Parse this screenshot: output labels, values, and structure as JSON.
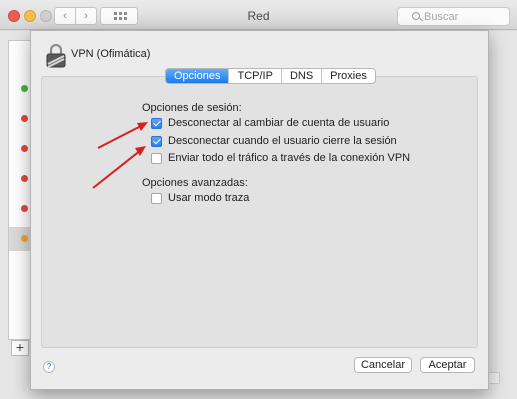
{
  "window": {
    "title": "Red",
    "search_placeholder": "Buscar",
    "back_glyph": "‹",
    "forward_glyph": "›",
    "add_glyph": "+",
    "help_glyph": "?"
  },
  "service_list": {
    "status_colors": [
      "#3fb642",
      "#e04a43",
      "#e04a43",
      "#e04a43",
      "#e04a43",
      "#f0a536"
    ]
  },
  "sheet": {
    "vpn_name": "VPN (Ofimática)",
    "tabs": [
      {
        "label": "Opciones",
        "active": true
      },
      {
        "label": "TCP/IP",
        "active": false
      },
      {
        "label": "DNS",
        "active": false
      },
      {
        "label": "Proxies",
        "active": false
      }
    ],
    "session_options_title": "Opciones de sesión:",
    "session_options": [
      {
        "label": "Desconectar al cambiar de cuenta de usuario",
        "checked": true
      },
      {
        "label": "Desconectar cuando el usuario cierre la sesión",
        "checked": true
      },
      {
        "label": "Enviar todo el tráfico a través de la conexión VPN",
        "checked": false
      }
    ],
    "advanced_options_title": "Opciones avanzadas:",
    "advanced_options": [
      {
        "label": "Usar modo traza",
        "checked": false
      }
    ],
    "help_glyph": "?",
    "cancel_label": "Cancelar",
    "accept_label": "Aceptar"
  },
  "annotation_color": "#d62020"
}
